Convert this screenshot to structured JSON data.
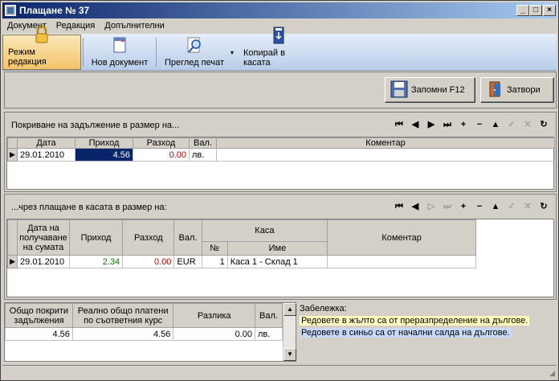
{
  "window": {
    "title": "Плащане № 37"
  },
  "menu": [
    "Документ",
    "Редакция",
    "Допълнителни"
  ],
  "toolbar": {
    "edit_mode": "Режим редакция",
    "new_doc": "Нов документ",
    "print_preview": "Преглед печат",
    "copy_to_cash": "Копирай в касата"
  },
  "actions": {
    "save": "Запомни  F12",
    "close": "Затвори"
  },
  "obligations": {
    "title": "Покриване на задължение в размер на...",
    "columns": [
      "Дата",
      "Приход",
      "Разход",
      "Вал.",
      "Коментар"
    ],
    "rows": [
      {
        "date": "29.01.2010",
        "income": "4.56",
        "expense": "0.00",
        "currency": "лв.",
        "comment": ""
      }
    ]
  },
  "payments": {
    "title": "...чрез плащане в касата в размер на:",
    "columns": {
      "date": "Дата на получаване на сумата",
      "income": "Приход",
      "expense": "Разход",
      "currency": "Вал.",
      "cash": "Каса",
      "num": "№",
      "name": "Име",
      "comment": "Коментар"
    },
    "rows": [
      {
        "date": "29.01.2010",
        "income": "2.34",
        "expense": "0.00",
        "currency": "EUR",
        "num": "1",
        "name": "Каса 1 - Склад 1",
        "comment": ""
      }
    ]
  },
  "summary": {
    "columns": {
      "covered": "Общо покрити задължения",
      "paid": "Реално общо платени по съответния курс",
      "diff": "Разлика",
      "currency": "Вал."
    },
    "row": {
      "covered": "4.56",
      "paid": "4.56",
      "diff": "0.00",
      "currency": "лв."
    }
  },
  "note": {
    "label": "Забележка:",
    "yellow": "Редовете в жълто са от преразпределение на дългове.",
    "blue": "Редовете в синьо са от начални салда на дългове."
  },
  "colors": {
    "title_start": "#0a246a",
    "title_end": "#a6caf0",
    "income": "#008000",
    "expense": "#c00000"
  }
}
